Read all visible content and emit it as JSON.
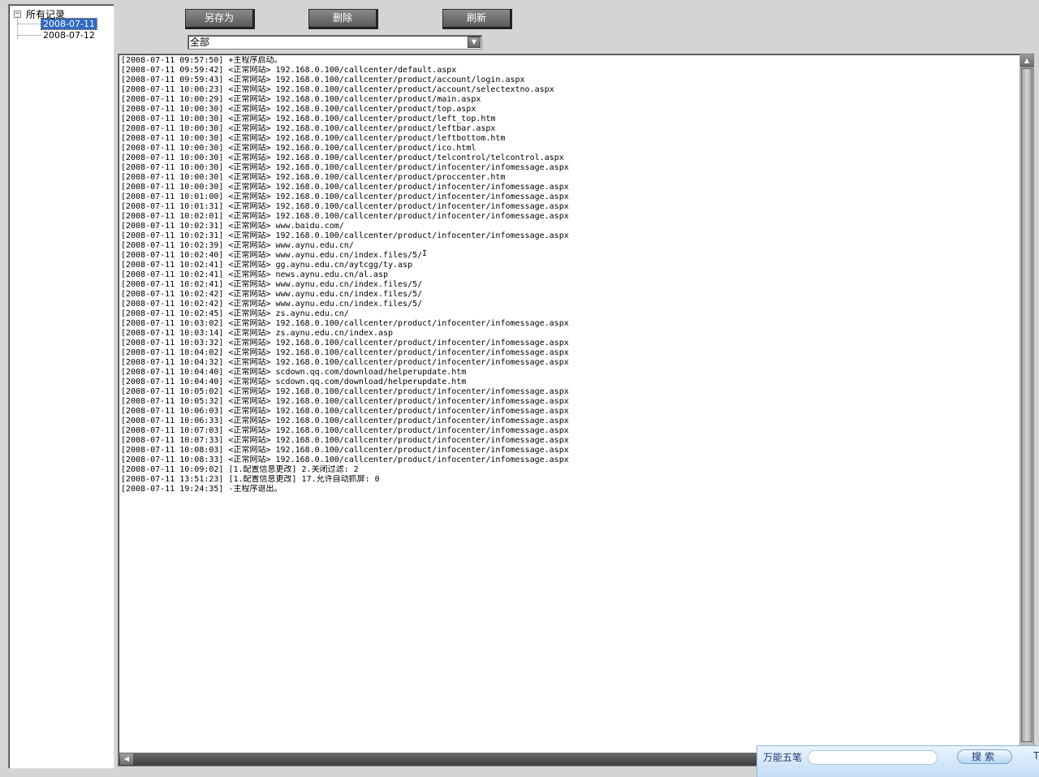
{
  "tree": {
    "root_label": "所有记录",
    "toggle": "−",
    "children": [
      {
        "label": "2008-07-11",
        "selected": true
      },
      {
        "label": "2008-07-12",
        "selected": false
      }
    ]
  },
  "toolbar": {
    "save_as_label": "另存为",
    "delete_label": "删除",
    "refresh_label": "刷新"
  },
  "filter": {
    "selected": "全部",
    "arrow": "▼"
  },
  "log": {
    "lines": [
      "[2008-07-11 09:57:50] +主程序启动。",
      "[2008-07-11 09:59:42] <正常网站> 192.168.0.100/callcenter/default.aspx",
      "[2008-07-11 09:59:43] <正常网站> 192.168.0.100/callcenter/product/account/login.aspx",
      "[2008-07-11 10:00:23] <正常网站> 192.168.0.100/callcenter/product/account/selectextno.aspx",
      "[2008-07-11 10:00:29] <正常网站> 192.168.0.100/callcenter/product/main.aspx",
      "[2008-07-11 10:00:30] <正常网站> 192.168.0.100/callcenter/product/top.aspx",
      "[2008-07-11 10:00:30] <正常网站> 192.168.0.100/callcenter/product/left_top.htm",
      "[2008-07-11 10:00:30] <正常网站> 192.168.0.100/callcenter/product/leftbar.aspx",
      "[2008-07-11 10:00:30] <正常网站> 192.168.0.100/callcenter/product/leftbottom.htm",
      "[2008-07-11 10:00:30] <正常网站> 192.168.0.100/callcenter/product/ico.html",
      "[2008-07-11 10:00:30] <正常网站> 192.168.0.100/callcenter/product/telcontrol/telcontrol.aspx",
      "[2008-07-11 10:00:30] <正常网站> 192.168.0.100/callcenter/product/infocenter/infomessage.aspx",
      "[2008-07-11 10:00:30] <正常网站> 192.168.0.100/callcenter/product/proccenter.htm",
      "[2008-07-11 10:00:30] <正常网站> 192.168.0.100/callcenter/product/infocenter/infomessage.aspx",
      "[2008-07-11 10:01:00] <正常网站> 192.168.0.100/callcenter/product/infocenter/infomessage.aspx",
      "[2008-07-11 10:01:31] <正常网站> 192.168.0.100/callcenter/product/infocenter/infomessage.aspx",
      "[2008-07-11 10:02:01] <正常网站> 192.168.0.100/callcenter/product/infocenter/infomessage.aspx",
      "[2008-07-11 10:02:31] <正常网站> www.baidu.com/",
      "[2008-07-11 10:02:31] <正常网站> 192.168.0.100/callcenter/product/infocenter/infomessage.aspx",
      "[2008-07-11 10:02:39] <正常网站> www.aynu.edu.cn/",
      "[2008-07-11 10:02:40] <正常网站> www.aynu.edu.cn/index.files/5/",
      "[2008-07-11 10:02:41] <正常网站> gg.aynu.edu.cn/aytcgg/ty.asp",
      "[2008-07-11 10:02:41] <正常网站> news.aynu.edu.cn/al.asp",
      "[2008-07-11 10:02:41] <正常网站> www.aynu.edu.cn/index.files/5/",
      "[2008-07-11 10:02:42] <正常网站> www.aynu.edu.cn/index.files/5/",
      "[2008-07-11 10:02:42] <正常网站> www.aynu.edu.cn/index.files/5/",
      "[2008-07-11 10:02:45] <正常网站> zs.aynu.edu.cn/",
      "[2008-07-11 10:03:02] <正常网站> 192.168.0.100/callcenter/product/infocenter/infomessage.aspx",
      "[2008-07-11 10:03:14] <正常网站> zs.aynu.edu.cn/index.asp",
      "[2008-07-11 10:03:32] <正常网站> 192.168.0.100/callcenter/product/infocenter/infomessage.aspx",
      "[2008-07-11 10:04:02] <正常网站> 192.168.0.100/callcenter/product/infocenter/infomessage.aspx",
      "[2008-07-11 10:04:32] <正常网站> 192.168.0.100/callcenter/product/infocenter/infomessage.aspx",
      "[2008-07-11 10:04:40] <正常网站> scdown.qq.com/download/helperupdate.htm",
      "[2008-07-11 10:04:40] <正常网站> scdown.qq.com/download/helperupdate.htm",
      "[2008-07-11 10:05:02] <正常网站> 192.168.0.100/callcenter/product/infocenter/infomessage.aspx",
      "[2008-07-11 10:05:32] <正常网站> 192.168.0.100/callcenter/product/infocenter/infomessage.aspx",
      "[2008-07-11 10:06:03] <正常网站> 192.168.0.100/callcenter/product/infocenter/infomessage.aspx",
      "[2008-07-11 10:06:33] <正常网站> 192.168.0.100/callcenter/product/infocenter/infomessage.aspx",
      "[2008-07-11 10:07:03] <正常网站> 192.168.0.100/callcenter/product/infocenter/infomessage.aspx",
      "[2008-07-11 10:07:33] <正常网站> 192.168.0.100/callcenter/product/infocenter/infomessage.aspx",
      "[2008-07-11 10:08:03] <正常网站> 192.168.0.100/callcenter/product/infocenter/infomessage.aspx",
      "[2008-07-11 10:08:33] <正常网站> 192.168.0.100/callcenter/product/infocenter/infomessage.aspx",
      "[2008-07-11 10:09:02] [1.配置信息更改] 2.关闭过滤: 2",
      "[2008-07-11 13:51:23] [1.配置信息更改] 17.允许自动抓屏: 0",
      "[2008-07-11 19:24:35] -主程序退出。"
    ]
  },
  "scroll": {
    "up_arrow": "▲",
    "left_arrow": "◀"
  },
  "ime": {
    "name": "万能五笔",
    "search_label": "搜索",
    "extra": "T"
  },
  "colors": {
    "selection": "#316ac5",
    "button": "#6a6a6a",
    "background": "#d4d4d4"
  }
}
